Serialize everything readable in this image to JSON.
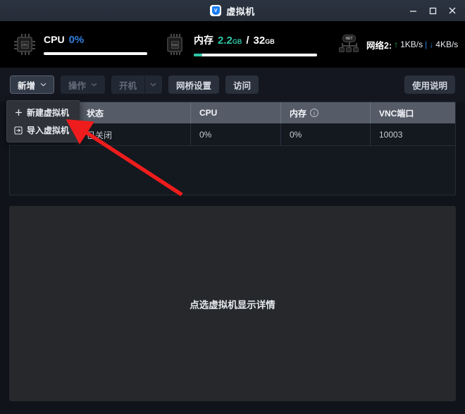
{
  "window": {
    "title": "虚拟机",
    "app_icon": "shield-v-icon",
    "controls": {
      "minimize": "minimize-icon",
      "maximize": "maximize-icon",
      "close": "close-icon"
    }
  },
  "stats": {
    "cpu": {
      "icon": "cpu-chip-icon",
      "label": "CPU",
      "value": "0%",
      "percent": 0
    },
    "memory": {
      "icon": "ram-chip-icon",
      "label": "内存",
      "used": "2.2",
      "used_unit": "GB",
      "separator": "/",
      "total": "32",
      "total_unit": "GB",
      "percent": 7
    },
    "network": {
      "icon": "network-icon",
      "label": "网络2:",
      "up_arrow": "↑",
      "up_value": "1KB/s",
      "divider": "|",
      "down_arrow": "↓",
      "down_value": "4KB/s"
    }
  },
  "toolbar": {
    "new_label": "新增",
    "new_chevron": "⌄",
    "operate_label": "操作",
    "operate_chevron": "⌄",
    "poweron_label": "开机",
    "poweron_chevron": "⌄",
    "bridge_label": "网桥设置",
    "access_label": "访问",
    "help_label": "使用说明"
  },
  "dropdown": {
    "items": [
      {
        "icon": "plus-icon",
        "label": "新建虚拟机"
      },
      {
        "icon": "import-icon",
        "label": "导入虚拟机"
      }
    ]
  },
  "table": {
    "columns": [
      "",
      "状态",
      "CPU",
      "内存",
      "VNC端口"
    ],
    "memory_info_icon": "info-icon",
    "rows": [
      {
        "select": "",
        "status": "已关闭",
        "cpu": "0%",
        "memory": "0%",
        "vnc_port": "10003"
      }
    ]
  },
  "detail": {
    "placeholder": "点选虚拟机显示详情"
  },
  "annotation": {
    "type": "arrow",
    "color": "#ee1c1c"
  },
  "colors": {
    "accent_blue": "#2f7fe0",
    "accent_green": "#2ec7a6",
    "net_up": "#23b14d",
    "net_down": "#2f7fe0",
    "header_bg": "#555b67",
    "annotation_red": "#ee1c1c"
  }
}
